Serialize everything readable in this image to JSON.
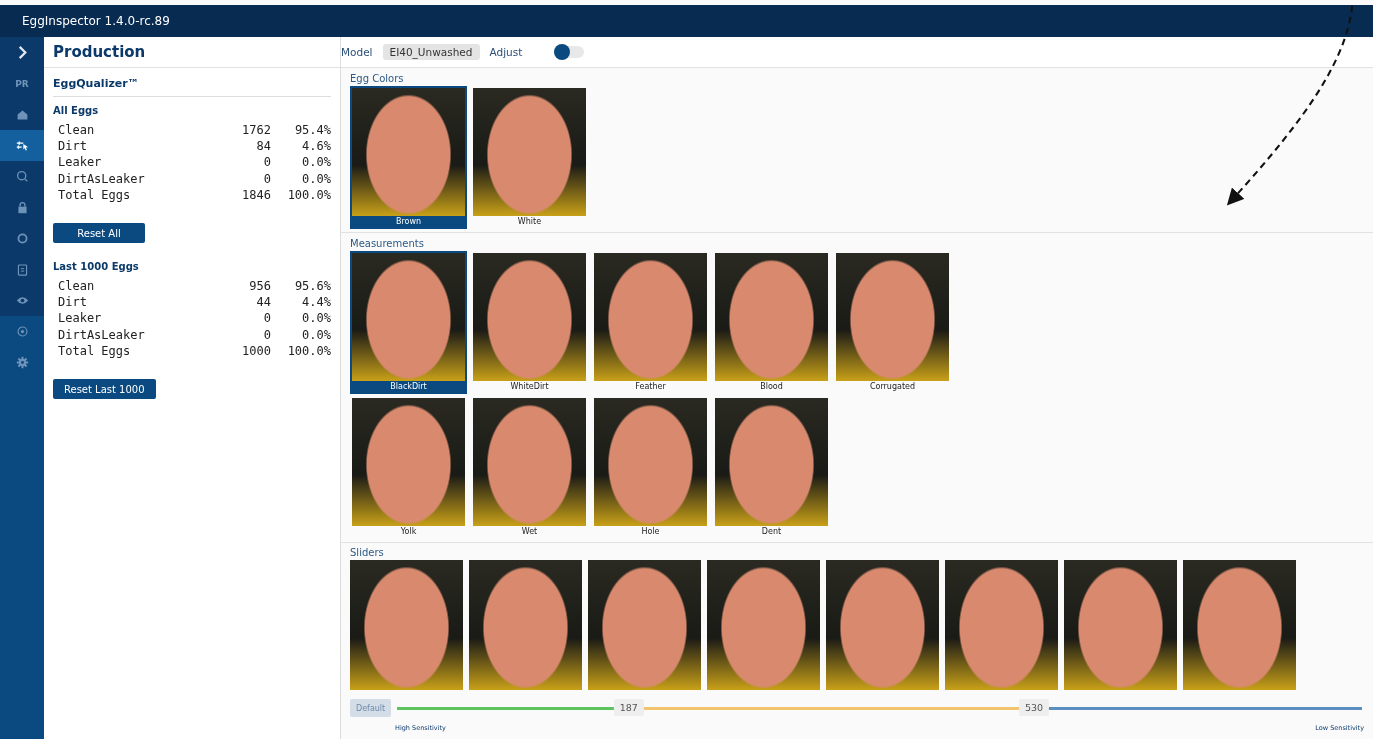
{
  "window": {
    "title": "EggInspector 1.4.0-rc.89"
  },
  "nav": [
    {
      "kind": "expand",
      "selected": false
    },
    {
      "kind": "pr",
      "label": "PR",
      "selected": false
    },
    {
      "kind": "home",
      "selected": false
    },
    {
      "kind": "sliders",
      "selected": true
    },
    {
      "kind": "search",
      "selected": false
    },
    {
      "kind": "lock",
      "selected": false
    },
    {
      "kind": "circle",
      "selected": false
    },
    {
      "kind": "clipboard",
      "selected": false
    },
    {
      "kind": "eye",
      "selected": false
    },
    {
      "kind": "target",
      "selected": false
    },
    {
      "kind": "gear",
      "selected": false
    }
  ],
  "panel": {
    "title": "Production",
    "subtitle": "EggQualizer™",
    "groups": [
      {
        "title": "All Eggs",
        "rows": [
          {
            "label": "Clean",
            "count": "1762",
            "percent": "95.4%"
          },
          {
            "label": "Dirt",
            "count": "84",
            "percent": "4.6%"
          },
          {
            "label": "Leaker",
            "count": "0",
            "percent": "0.0%"
          },
          {
            "label": "DirtAsLeaker",
            "count": "0",
            "percent": "0.0%"
          },
          {
            "label": "Total Eggs",
            "count": "1846",
            "percent": "100.0%"
          }
        ],
        "button": "Reset All"
      },
      {
        "title": "Last 1000 Eggs",
        "rows": [
          {
            "label": "Clean",
            "count": "956",
            "percent": "95.6%"
          },
          {
            "label": "Dirt",
            "count": "44",
            "percent": "4.4%"
          },
          {
            "label": "Leaker",
            "count": "0",
            "percent": "0.0%"
          },
          {
            "label": "DirtAsLeaker",
            "count": "0",
            "percent": "0.0%"
          },
          {
            "label": "Total Eggs",
            "count": "1000",
            "percent": "100.0%"
          }
        ],
        "button": "Reset Last 1000"
      }
    ]
  },
  "toolbar": {
    "model_label": "Model",
    "model": "EI40_Unwashed",
    "adjust_label": "Adjust",
    "adjust_on": false
  },
  "sections": [
    {
      "title": "Egg Colors",
      "tiles": [
        {
          "label": "Brown",
          "selected": true
        },
        {
          "label": "White",
          "selected": false
        }
      ]
    },
    {
      "title": "Measurements",
      "tiles": [
        {
          "label": "BlackDirt",
          "selected": true
        },
        {
          "label": "WhiteDirt",
          "selected": false
        },
        {
          "label": "Feather",
          "selected": false
        },
        {
          "label": "Blood",
          "selected": false
        },
        {
          "label": "Corrugated",
          "selected": false
        },
        {
          "label": "Yolk",
          "selected": false
        },
        {
          "label": "Wet",
          "selected": false
        },
        {
          "label": "Hole",
          "selected": false
        },
        {
          "label": "Dent",
          "selected": false
        }
      ]
    }
  ],
  "sliders": {
    "title": "Sliders",
    "default_button": "Default",
    "default_disabled": true,
    "thumbs": [
      {
        "reading": "187",
        "level": 0.24
      },
      {
        "reading": "530",
        "level": 0.66
      }
    ],
    "low_label": "High Sensitivity",
    "high_label": "Low Sensitivity"
  }
}
